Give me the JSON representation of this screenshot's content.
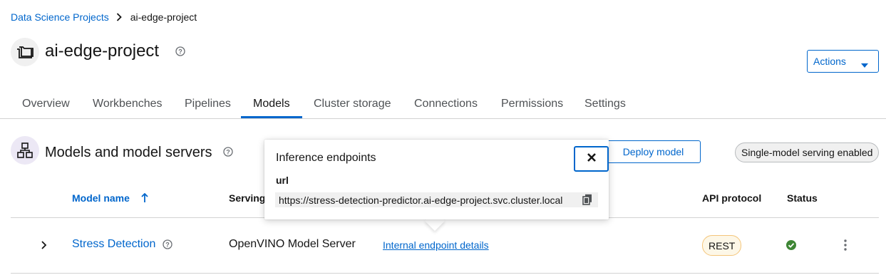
{
  "breadcrumb": {
    "parent": "Data Science Projects",
    "current": "ai-edge-project"
  },
  "project": {
    "title": "ai-edge-project",
    "icon": "project-folder-icon"
  },
  "actions": {
    "label": "Actions"
  },
  "tabs": [
    {
      "label": "Overview"
    },
    {
      "label": "Workbenches"
    },
    {
      "label": "Pipelines"
    },
    {
      "label": "Models",
      "active": true
    },
    {
      "label": "Cluster storage"
    },
    {
      "label": "Connections"
    },
    {
      "label": "Permissions"
    },
    {
      "label": "Settings"
    }
  ],
  "section": {
    "title": "Models and model servers",
    "deploy_label": "Deploy model",
    "serving_label": "Single-model serving enabled"
  },
  "table": {
    "headers": {
      "model_name": "Model name",
      "serving": "Serving",
      "api_protocol": "API protocol",
      "status": "Status"
    },
    "rows": [
      {
        "model_name": "Stress Detection",
        "runtime": "OpenVINO Model Server",
        "endpoint_link": "Internal endpoint details",
        "api_protocol": "REST",
        "status": "success"
      }
    ]
  },
  "popover": {
    "title": "Inference endpoints",
    "label": "url",
    "url": "https://stress-detection-predictor.ai-edge-project.svc.cluster.local"
  },
  "colors": {
    "link": "#0066cc",
    "success": "#3e8635",
    "section_icon_bg": "#ece8f5"
  }
}
